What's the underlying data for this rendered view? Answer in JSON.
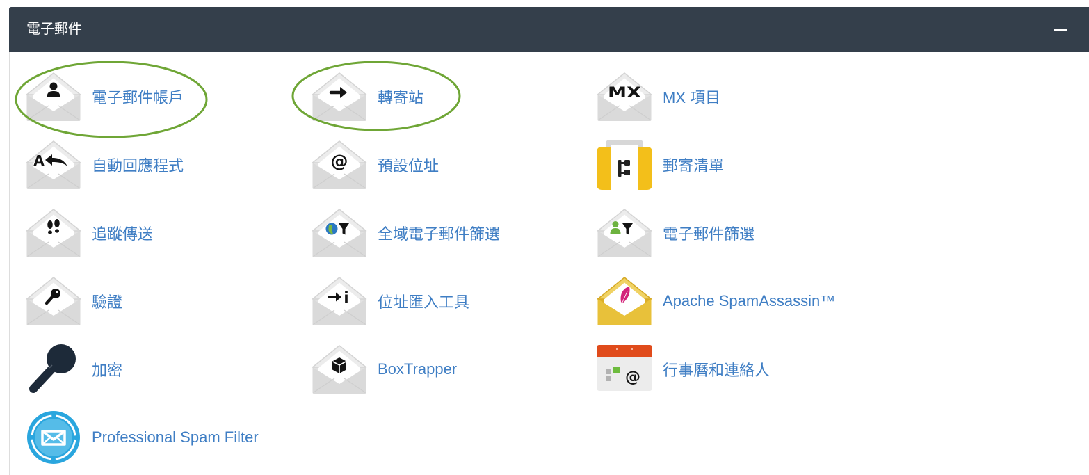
{
  "panel": {
    "title": "電子郵件",
    "collapse_icon": "minus-icon",
    "header_color": "#343f4b"
  },
  "colors": {
    "link": "#3f7ec4",
    "highlight": "#6fa636",
    "envelope_gray": "#dcdcdc",
    "envelope_gold": "#e8c13a",
    "mailing_list_yellow": "#f3bf1a",
    "calendar_red": "#e04b1b",
    "spam_filter_blue": "#2aa6de",
    "key_navy": "#1d2a39"
  },
  "items": [
    {
      "label": "電子郵件帳戶",
      "icon": "email-accounts-icon",
      "highlighted": true
    },
    {
      "label": "轉寄站",
      "icon": "forwarders-icon",
      "highlighted": true
    },
    {
      "label": "MX 項目",
      "icon": "mx-entry-icon",
      "glyph": "MX"
    },
    {
      "label": "自動回應程式",
      "icon": "autoresponders-icon",
      "glyph": "A"
    },
    {
      "label": "預設位址",
      "icon": "default-address-icon",
      "glyph": "@"
    },
    {
      "label": "郵寄清單",
      "icon": "mailing-lists-icon"
    },
    {
      "label": "追蹤傳送",
      "icon": "track-delivery-icon"
    },
    {
      "label": "全域電子郵件篩選",
      "icon": "global-email-filters-icon"
    },
    {
      "label": "電子郵件篩選",
      "icon": "email-filters-icon"
    },
    {
      "label": "驗證",
      "icon": "authentication-icon"
    },
    {
      "label": "位址匯入工具",
      "icon": "address-importer-icon",
      "glyph": "i"
    },
    {
      "label": "Apache SpamAssassin™",
      "icon": "spamassassin-icon"
    },
    {
      "label": "加密",
      "icon": "encryption-key-icon"
    },
    {
      "label": "BoxTrapper",
      "icon": "boxtrapper-icon"
    },
    {
      "label": "行事曆和連絡人",
      "icon": "calendars-contacts-icon",
      "glyph": "@"
    },
    {
      "label": "Professional Spam Filter",
      "icon": "professional-spam-filter-icon"
    }
  ]
}
